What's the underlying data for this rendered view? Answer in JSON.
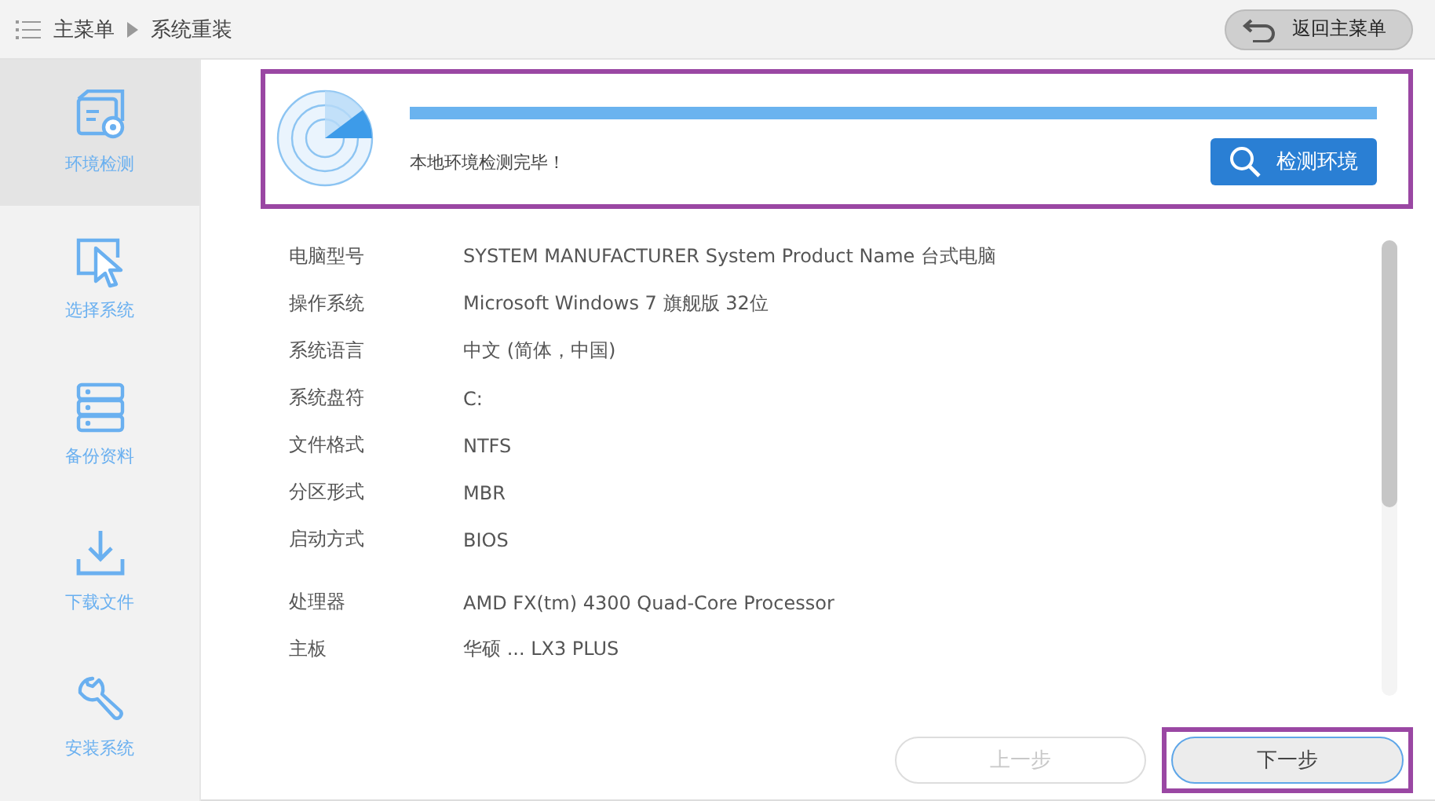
{
  "breadcrumb": [
    "主菜单",
    "系统重装"
  ],
  "back_button": "返回主菜单",
  "sidebar": {
    "items": [
      {
        "label": "环境检测",
        "kind": "settings",
        "selected": true
      },
      {
        "label": "选择系统",
        "kind": "cursor",
        "selected": false
      },
      {
        "label": "备份资料",
        "kind": "storage",
        "selected": false
      },
      {
        "label": "下载文件",
        "kind": "download",
        "selected": false
      },
      {
        "label": "安装系统",
        "kind": "wrench",
        "selected": false
      }
    ]
  },
  "detect_panel": {
    "level": 1,
    "message": "本地环境检测完毕！",
    "button": "检测环境",
    "highlighted": true
  },
  "info_groups": [
    {
      "rows": [
        {
          "label": "电脑型号",
          "value": "SYSTEM MANUFACTURER System Product Name 台式电脑"
        },
        {
          "label": "操作系统",
          "value": "Microsoft Windows 7 旗舰版 32位"
        },
        {
          "label": "系统语言",
          "value": "中文 (简体，中国)"
        },
        {
          "label": "系统盘符",
          "value": "C:"
        },
        {
          "label": "文件格式",
          "value": "NTFS"
        },
        {
          "label": "分区形式",
          "value": "MBR"
        },
        {
          "label": "启动方式",
          "value": "BIOS"
        }
      ]
    },
    {
      "rows": [
        {
          "label": "处理器",
          "value": "AMD FX(tm) 4300 Quad-Core Processor"
        },
        {
          "label": "主板",
          "value": "华硕 ... LX3 PLUS"
        }
      ]
    }
  ],
  "footer": {
    "buttons": [
      {
        "label": "上一步",
        "disabled": true,
        "highlighted": false
      },
      {
        "label": "下一步",
        "disabled": false,
        "highlighted": true
      }
    ]
  }
}
